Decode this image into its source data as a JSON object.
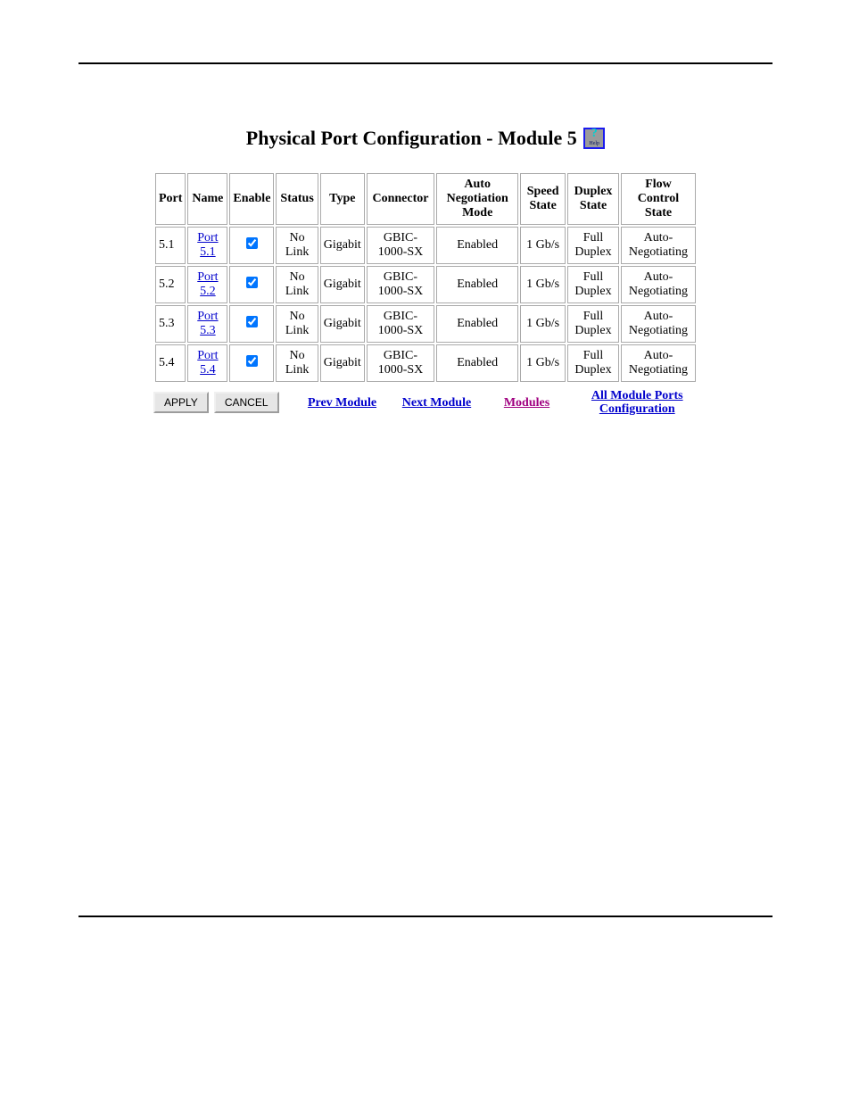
{
  "title": "Physical Port Configuration - Module 5",
  "help_icon": {
    "qmark": "?",
    "text": "Help"
  },
  "columns": {
    "port": "Port",
    "name": "Name",
    "enable": "Enable",
    "status": "Status",
    "type": "Type",
    "connector": "Connector",
    "autoneg": "Auto Negotiation Mode",
    "speed": "Speed State",
    "duplex": "Duplex State",
    "flow": "Flow Control State"
  },
  "rows": [
    {
      "port": "5.1",
      "name": "Port 5.1",
      "enable": true,
      "status": "No Link",
      "type": "Gigabit",
      "connector": "GBIC-1000-SX",
      "autoneg": "Enabled",
      "speed": "1 Gb/s",
      "duplex": "Full Duplex",
      "flow": "Auto-Negotiating"
    },
    {
      "port": "5.2",
      "name": "Port 5.2",
      "enable": true,
      "status": "No Link",
      "type": "Gigabit",
      "connector": "GBIC-1000-SX",
      "autoneg": "Enabled",
      "speed": "1 Gb/s",
      "duplex": "Full Duplex",
      "flow": "Auto-Negotiating"
    },
    {
      "port": "5.3",
      "name": "Port 5.3",
      "enable": true,
      "status": "No Link",
      "type": "Gigabit",
      "connector": "GBIC-1000-SX",
      "autoneg": "Enabled",
      "speed": "1 Gb/s",
      "duplex": "Full Duplex",
      "flow": "Auto-Negotiating"
    },
    {
      "port": "5.4",
      "name": "Port 5.4",
      "enable": true,
      "status": "No Link",
      "type": "Gigabit",
      "connector": "GBIC-1000-SX",
      "autoneg": "Enabled",
      "speed": "1 Gb/s",
      "duplex": "Full Duplex",
      "flow": "Auto-Negotiating"
    }
  ],
  "footer": {
    "apply": "APPLY",
    "cancel": "CANCEL",
    "prev_module": "Prev Module",
    "next_module": "Next Module",
    "modules": "Modules",
    "all_ports": "All Module Ports Configuration"
  }
}
